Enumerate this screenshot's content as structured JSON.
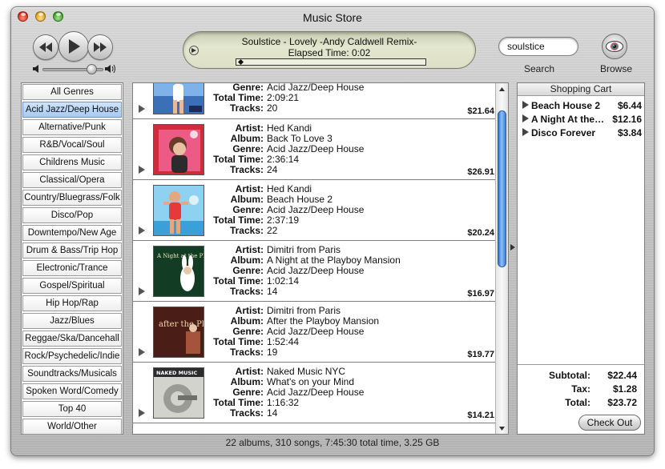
{
  "window": {
    "title": "Music Store"
  },
  "now_playing": {
    "track": "Soulstice - Lovely -Andy Caldwell Remix-",
    "elapsed": "Elapsed Time: 0:02",
    "progress": 0.01
  },
  "volume": {
    "level": 0.8
  },
  "search": {
    "value": "soulstice",
    "label": "Search"
  },
  "browse": {
    "label": "Browse"
  },
  "genres": [
    "All Genres",
    "Acid Jazz/Deep House",
    "Alternative/Punk",
    "R&B/Vocal/Soul",
    "Childrens Music",
    "Classical/Opera",
    "Country/Bluegrass/Folk",
    "Disco/Pop",
    "Downtempo/New Age",
    "Drum & Bass/Trip Hop",
    "Electronic/Trance",
    "Gospel/Spiritual",
    "Hip Hop/Rap",
    "Jazz/Blues",
    "Reggae/Ska/Dancehall",
    "Rock/Psychedelic/Indie",
    "Soundtracks/Musicals",
    "Spoken Word/Comedy",
    "Top 40",
    "World/Other"
  ],
  "selected_genre_index": 1,
  "field_labels": {
    "artist": "Artist:",
    "album": "Album:",
    "genre": "Genre:",
    "total_time": "Total Time:",
    "tracks": "Tracks:"
  },
  "albums": [
    {
      "artist": "",
      "album": "",
      "genre": "Acid Jazz/Deep House",
      "total_time": "2:09:21",
      "tracks": "20",
      "price": "$21.64"
    },
    {
      "artist": "Hed Kandi",
      "album": "Back To Love 3",
      "genre": "Acid Jazz/Deep House",
      "total_time": "2:36:14",
      "tracks": "24",
      "price": "$26.91"
    },
    {
      "artist": "Hed Kandi",
      "album": "Beach House 2",
      "genre": "Acid Jazz/Deep House",
      "total_time": "2:37:19",
      "tracks": "22",
      "price": "$20.24"
    },
    {
      "artist": "Dimitri from Paris",
      "album": "A Night at the Playboy Mansion",
      "genre": "Acid Jazz/Deep House",
      "total_time": "1:02:14",
      "tracks": "14",
      "price": "$16.97"
    },
    {
      "artist": "Dimitri from Paris",
      "album": "After the Playboy Mansion",
      "genre": "Acid Jazz/Deep House",
      "total_time": "1:52:44",
      "tracks": "19",
      "price": "$19.77"
    },
    {
      "artist": "Naked Music NYC",
      "album": "What's on your Mind",
      "genre": "Acid Jazz/Deep House",
      "total_time": "1:16:32",
      "tracks": "14",
      "price": "$14.21"
    }
  ],
  "covers": {
    "a_night": "A Night at the Playboy Mansion",
    "after": "after the Playboy Mansion",
    "naked": "NAKED MUSIC"
  },
  "cart": {
    "title": "Shopping Cart",
    "items": [
      {
        "name": "Beach House 2",
        "price": "$6.44"
      },
      {
        "name": "A Night At the Playboy Mansion",
        "price": "$12.16"
      },
      {
        "name": "Disco Forever",
        "price": "$3.84"
      }
    ],
    "subtotal_label": "Subtotal:",
    "subtotal": "$22.44",
    "tax_label": "Tax:",
    "tax": "$1.28",
    "total_label": "Total:",
    "total": "$23.72",
    "checkout_label": "Check Out"
  },
  "status": "22 albums, 310 songs, 7:45:30 total time, 3.25 GB",
  "colors": {
    "selection": "#a7cbf3",
    "scroll_thumb": "#3b7fdb",
    "lcd": "#e4e7cf"
  }
}
